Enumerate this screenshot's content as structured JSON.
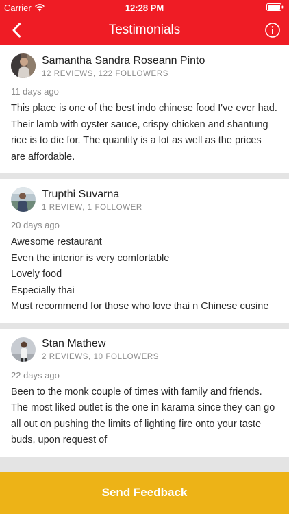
{
  "status_bar": {
    "carrier": "Carrier",
    "time": "12:28 PM",
    "signal_icon": "wifi-icon",
    "battery_icon": "battery-icon"
  },
  "nav": {
    "title": "Testimonials",
    "back_icon": "chevron-left-icon",
    "info_icon": "info-icon"
  },
  "reviews": [
    {
      "name": "Samantha Sandra Roseann Pinto",
      "meta": "12 REVIEWS, 122 FOLLOWERS",
      "date": "11 days ago",
      "text": "This place is one of the best indo chinese food I've ever had. Their lamb with oyster sauce, crispy chicken and shantung rice is to die for. The quantity is a lot as well as the prices are affordable."
    },
    {
      "name": "Trupthi Suvarna",
      "meta": "1 REVIEW, 1 FOLLOWER",
      "date": "20 days ago",
      "text": "Awesome restaurant\nEven the interior is very comfortable\nLovely food\nEspecially thai\nMust recommend for those who love thai n Chinese cusine"
    },
    {
      "name": "Stan Mathew",
      "meta": "2 REVIEWS, 10 FOLLOWERS",
      "date": "22 days ago",
      "text": "Been to the monk couple of times with family and friends. The most liked outlet is the one in karama since they can go all out on pushing the limits of lighting fire onto your taste buds, upon request of"
    }
  ],
  "footer": {
    "button_label": "Send Feedback"
  },
  "colors": {
    "header": "#ef1c25",
    "footer": "#edb317",
    "separator": "#e4e4e4"
  }
}
